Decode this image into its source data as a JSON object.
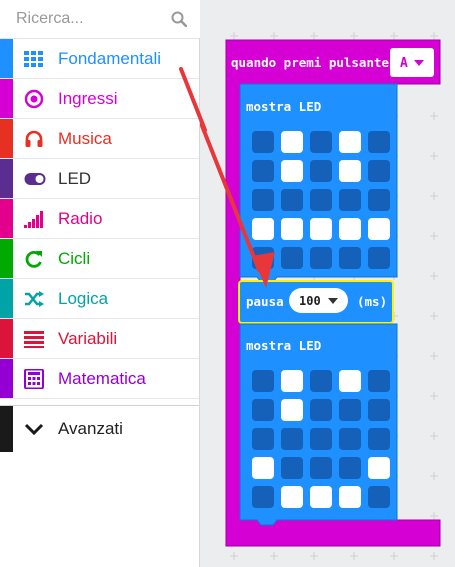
{
  "search": {
    "placeholder": "Ricerca..."
  },
  "categories": [
    {
      "label": "Fondamentali",
      "color": "#1e90ff",
      "icon": "grid-icon"
    },
    {
      "label": "Ingressi",
      "color": "#d400d4",
      "icon": "target-icon"
    },
    {
      "label": "Musica",
      "color": "#e63022",
      "icon": "headphones-icon"
    },
    {
      "label": "LED",
      "color": "#5c2d91",
      "icon": "toggle-icon"
    },
    {
      "label": "Radio",
      "color": "#e3008c",
      "icon": "signal-bars-icon"
    },
    {
      "label": "Cicli",
      "color": "#00aa00",
      "icon": "loop-arrow-icon"
    },
    {
      "label": "Logica",
      "color": "#00a4a6",
      "icon": "shuffle-icon"
    },
    {
      "label": "Variabili",
      "color": "#dc143c",
      "icon": "lines-icon"
    },
    {
      "label": "Matematica",
      "color": "#9400d3",
      "icon": "calculator-icon"
    }
  ],
  "advanced": {
    "label": "Avanzati",
    "color": "#1a1a1a",
    "icon": "chevron-down-icon"
  },
  "event_block": {
    "label": "quando premi pulsante",
    "dropdown_value": "A",
    "color": "#d400d4"
  },
  "show_leds_1": {
    "label": "mostra LED",
    "grid": [
      [
        0,
        1,
        0,
        1,
        0
      ],
      [
        0,
        1,
        0,
        1,
        0
      ],
      [
        0,
        0,
        0,
        0,
        0
      ],
      [
        1,
        1,
        1,
        1,
        1
      ],
      [
        0,
        0,
        0,
        0,
        0
      ]
    ]
  },
  "pause_block": {
    "label": "pausa",
    "value": "100",
    "unit": "(ms)"
  },
  "show_leds_2": {
    "label": "mostra LED",
    "grid": [
      [
        0,
        1,
        0,
        1,
        0
      ],
      [
        0,
        1,
        0,
        0,
        0
      ],
      [
        0,
        0,
        0,
        0,
        0
      ],
      [
        1,
        0,
        0,
        0,
        1
      ],
      [
        0,
        1,
        1,
        1,
        0
      ]
    ]
  },
  "colors": {
    "basic_block": "#1e90ff",
    "led_off": "#1560b8",
    "led_on": "#ffffff",
    "arrow": "#e8373a",
    "highlight": "#fff200"
  }
}
